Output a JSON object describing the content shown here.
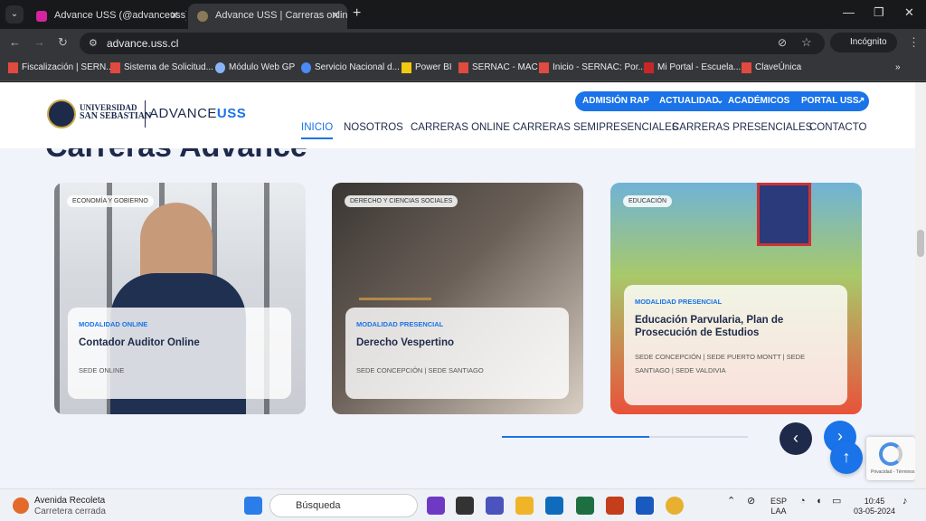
{
  "browser": {
    "tabs": [
      {
        "title": "Advance USS (@advanceuss) • Inst",
        "active": false,
        "color": "#d6249f"
      },
      {
        "title": "Advance USS | Carreras online, s",
        "active": true,
        "color": "#8a7a5a"
      }
    ],
    "url": "advance.uss.cl",
    "incognito_label": "Incógnito",
    "bookmarks": [
      {
        "label": "Fiscalización | SERN...",
        "color": "#e04a3f"
      },
      {
        "label": "Sistema de Solicitud...",
        "color": "#e04a3f"
      },
      {
        "label": "Módulo Web GP",
        "color": "#8ab4f8"
      },
      {
        "label": "Servicio Nacional d...",
        "color": "#4a8af4"
      },
      {
        "label": "Power BI",
        "color": "#f2c811"
      },
      {
        "label": "SERNAC - MAC",
        "color": "#e04a3f"
      },
      {
        "label": "Inicio - SERNAC: Por...",
        "color": "#e04a3f"
      },
      {
        "label": "Mi Portal - Escuela...",
        "color": "#c62828"
      },
      {
        "label": "ClaveÚnica",
        "color": "#e04a3f"
      }
    ]
  },
  "site": {
    "logo_university": "UNIVERSIDAD",
    "logo_university2": "SAN SEBASTIAN",
    "logo_advance": "ADVANCE",
    "logo_uss": "USS",
    "top_links": [
      "ADMISIÓN RAP",
      "ACTUALIDAD",
      "ACADÉMICOS",
      "PORTAL USS"
    ],
    "nav": [
      "INICIO",
      "NOSOTROS",
      "CARRERAS ONLINE",
      "CARRERAS SEMIPRESENCIALES",
      "CARRERAS PRESENCIALES",
      "CONTACTO"
    ],
    "section_title": "Carreras Advance",
    "cards": [
      {
        "tag": "ECONOMÍA Y GOBIERNO",
        "modality": "MODALIDAD ONLINE",
        "name": "Contador Auditor Online",
        "campus": "SEDE ONLINE"
      },
      {
        "tag": "DERECHO Y CIENCIAS SOCIALES",
        "modality": "MODALIDAD PRESENCIAL",
        "name": "Derecho Vespertino",
        "campus": "SEDE CONCEPCIÓN | SEDE SANTIAGO"
      },
      {
        "tag": "EDUCACIÓN",
        "modality": "MODALIDAD PRESENCIAL",
        "name": "Educación Parvularia, Plan de Prosecución de Estudios",
        "campus": "SEDE CONCEPCIÓN | SEDE PUERTO MONTT | SEDE SANTIAGO | SEDE VALDIVIA"
      }
    ],
    "carousel_progress": 0.6,
    "captcha_text": "Privacidad - Términos"
  },
  "taskbar": {
    "weather_title": "Avenida Recoleta",
    "weather_sub": "Carretera cerrada",
    "search_placeholder": "Búsqueda",
    "lang1": "ESP",
    "lang2": "LAA",
    "time": "10:45",
    "date": "03-05-2024"
  }
}
